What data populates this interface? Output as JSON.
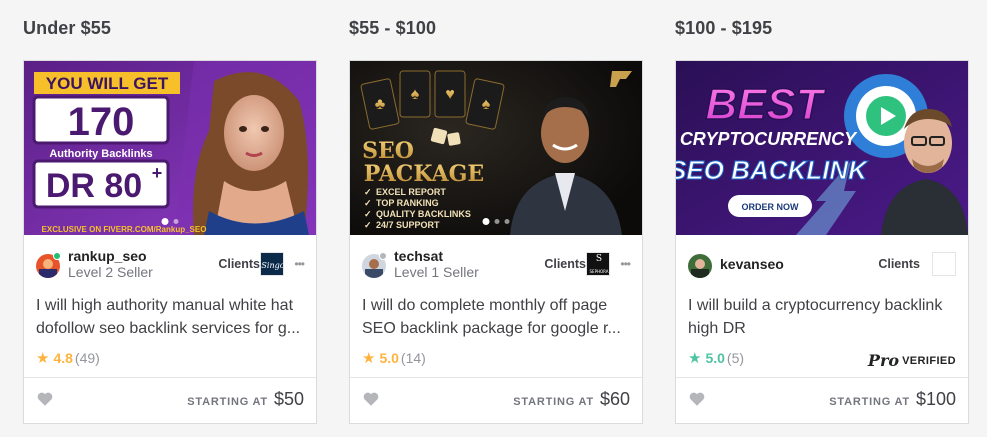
{
  "tiers": [
    {
      "title": "Under $55",
      "gig": {
        "image_text": {
          "line1": "YOU WILL GET",
          "line2": "170",
          "line3": "Authority Backlinks",
          "line4": "DR 80",
          "line4_sup": "+",
          "line5": "EXCLUSIVE ON FIVERR.COM/Rankup_SEO"
        },
        "seller_name": "rankup_seo",
        "seller_level": "Level 2 Seller",
        "clients_label": "Clients",
        "client_logo_text": "Singo",
        "title": "I will high authority manual white hat dofollow seo backlink services for google top ranking",
        "rating_value": "4.8",
        "rating_count": "(49)",
        "star_color": "#ffb33e",
        "starting_label": "STARTING AT",
        "price": "$50"
      }
    },
    {
      "title": "$55 - $100",
      "gig": {
        "image_text": {
          "line1": "SEO",
          "line2": "PACKAGE",
          "bullets": [
            "EXCEL REPORT",
            "TOP RANKING",
            "QUALITY BACKLINKS",
            "24/7 SUPPORT"
          ]
        },
        "seller_name": "techsat",
        "seller_level": "Level 1 Seller",
        "clients_label": "Clients",
        "client_logo_text": "SEPHORA",
        "title": "I will do complete monthly off page SEO backlink package for google ranking",
        "rating_value": "5.0",
        "rating_count": "(14)",
        "star_color": "#ffb33e",
        "starting_label": "STARTING AT",
        "price": "$60"
      }
    },
    {
      "title": "$100 - $195",
      "gig": {
        "image_text": {
          "line1": "BEST",
          "line2": "CRYPTOCURRENCY",
          "line3": "SEO BACKLINK",
          "cta": "ORDER NOW"
        },
        "seller_name": "kevanseo",
        "clients_label": "Clients",
        "title": "I will build a cryptocurrency backlink high DR",
        "rating_value": "5.0",
        "rating_count": "(5)",
        "star_color": "#4fc3a1",
        "pro_label": "Pro",
        "pro_verified": "VERIFIED",
        "starting_label": "STARTING AT",
        "price": "$100"
      }
    }
  ],
  "colors": {
    "rating_gold": "#ffb33e",
    "rating_teal": "#4fc3a1",
    "online_green": "#1dbf73",
    "text_dark": "#404145",
    "text_muted": "#74767e"
  }
}
